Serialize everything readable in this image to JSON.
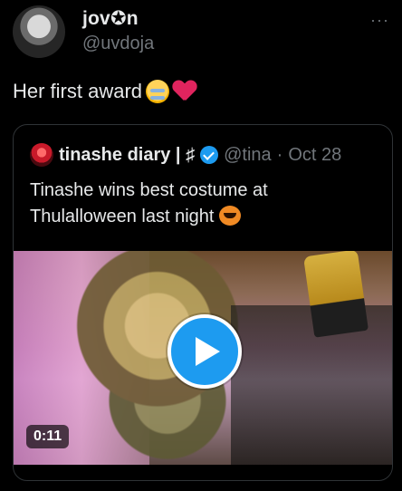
{
  "tweet": {
    "display_name": "jov✪n",
    "handle": "@uvdoja",
    "more_label": "···",
    "text": "Her first award",
    "emojis": [
      "loudly-crying-face",
      "red-heart"
    ]
  },
  "quoted": {
    "display_name": "tinashe diary | ♯",
    "handle": "@tina",
    "separator": "·",
    "date": "Oct 28",
    "text": "Tinashe wins best costume at Thulalloween last night",
    "media": {
      "duration": "0:11",
      "accent": "#1d9bf0"
    }
  }
}
